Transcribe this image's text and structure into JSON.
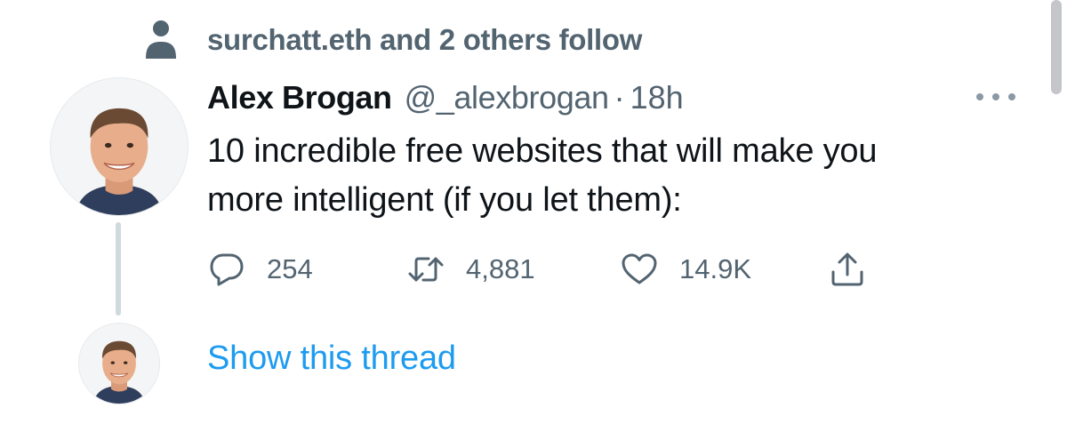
{
  "social_context": {
    "icon": "person-icon",
    "text": "surchatt.eth and 2 others follow"
  },
  "tweet": {
    "author_name": "Alex Brogan",
    "author_handle": "@_alexbrogan",
    "separator": "·",
    "time": "18h",
    "text_lines": [
      "10 incredible free websites that will make you",
      "more intelligent (if you let them):"
    ],
    "actions": {
      "reply": {
        "icon": "reply-icon",
        "count": "254"
      },
      "retweet": {
        "icon": "retweet-icon",
        "count": "4,881"
      },
      "like": {
        "icon": "heart-icon",
        "count": "14.9K"
      },
      "share": {
        "icon": "share-icon"
      }
    },
    "more_icon": "more-dots-icon"
  },
  "thread": {
    "show_thread_label": "Show this thread"
  },
  "colors": {
    "text_primary": "#0f1419",
    "text_secondary": "#536471",
    "link": "#1d9bf0",
    "thread_line": "#cfd9de"
  }
}
